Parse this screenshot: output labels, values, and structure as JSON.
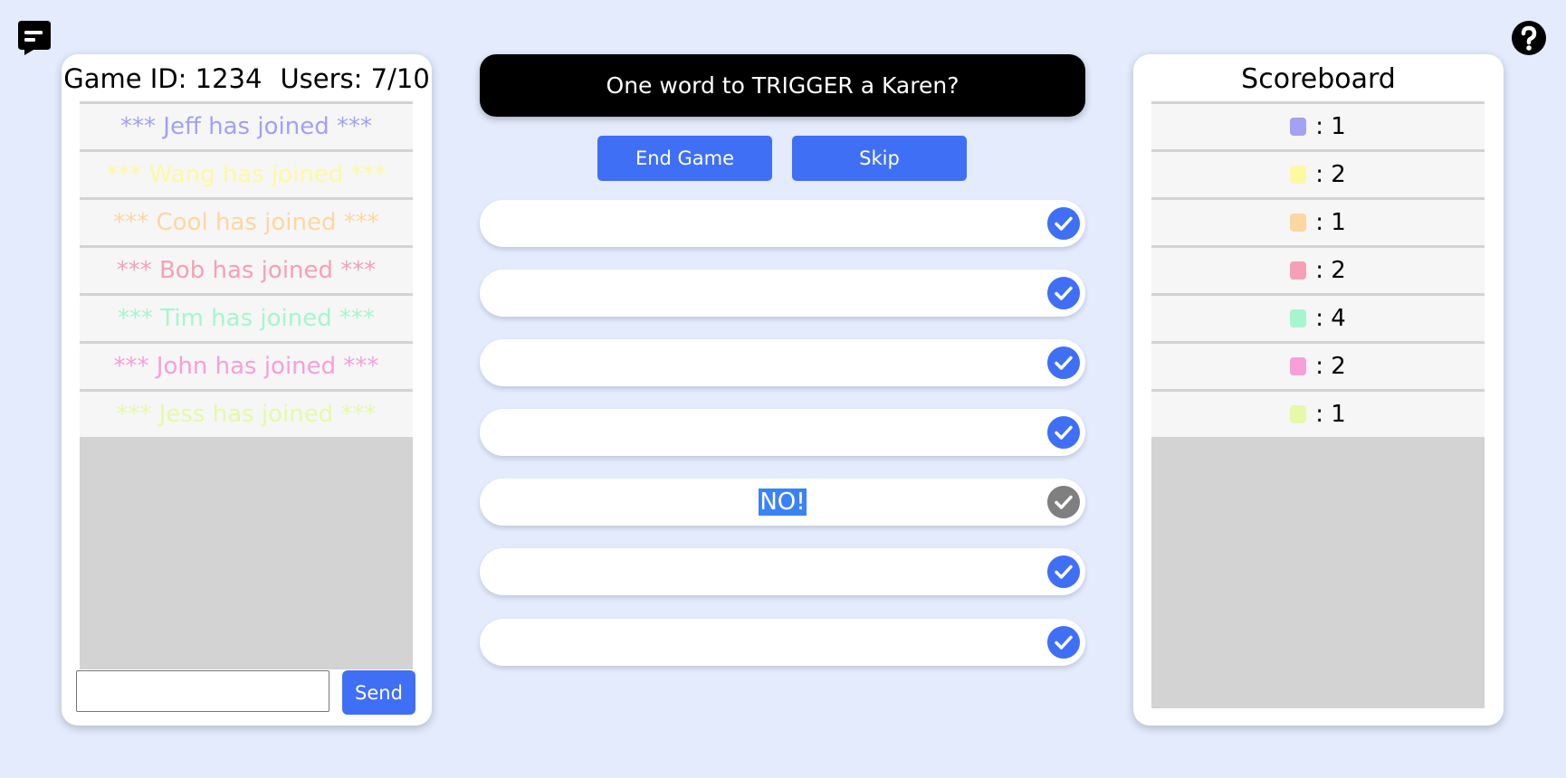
{
  "header": {
    "game_id_label": "Game ID: 1234",
    "users_label": "Users: 7/10"
  },
  "chat": {
    "messages": [
      {
        "text": "*** Jeff has joined ***",
        "color": "#a3a0f5"
      },
      {
        "text": "*** Wang has joined ***",
        "color": "#fdf9a3"
      },
      {
        "text": "*** Cool has joined ***",
        "color": "#fdd6a2"
      },
      {
        "text": "*** Bob has joined ***",
        "color": "#f5a0b6"
      },
      {
        "text": "*** Tim has joined ***",
        "color": "#a7f5cf"
      },
      {
        "text": "*** John has joined ***",
        "color": "#f5a0d8"
      },
      {
        "text": "*** Jess has joined ***",
        "color": "#e6f9a8"
      }
    ],
    "input_value": "",
    "send_label": "Send"
  },
  "game": {
    "question": "One word to TRIGGER a Karen?",
    "end_label": "End Game",
    "skip_label": "Skip",
    "answers": [
      {
        "text": "",
        "check_color": "#3f6ff5"
      },
      {
        "text": "",
        "check_color": "#3f6ff5"
      },
      {
        "text": "",
        "check_color": "#3f6ff5"
      },
      {
        "text": "",
        "check_color": "#3f6ff5"
      },
      {
        "text": "NO!",
        "check_color": "#7f7f7f",
        "selected": true
      },
      {
        "text": "",
        "check_color": "#3f6ff5"
      },
      {
        "text": "",
        "check_color": "#3f6ff5"
      }
    ]
  },
  "scoreboard": {
    "title": "Scoreboard",
    "rows": [
      {
        "color": "#a3a0f5",
        "score": ": 1"
      },
      {
        "color": "#fdf9a3",
        "score": ": 2"
      },
      {
        "color": "#fdd6a2",
        "score": ": 1"
      },
      {
        "color": "#f5a0b6",
        "score": ": 2"
      },
      {
        "color": "#a7f5cf",
        "score": ": 4"
      },
      {
        "color": "#f5a0d8",
        "score": ": 2"
      },
      {
        "color": "#e6f9a8",
        "score": ": 1"
      }
    ]
  },
  "icons": {
    "chat": "chat-bubble-icon",
    "help": "help-icon",
    "check": "check-circle-icon"
  }
}
